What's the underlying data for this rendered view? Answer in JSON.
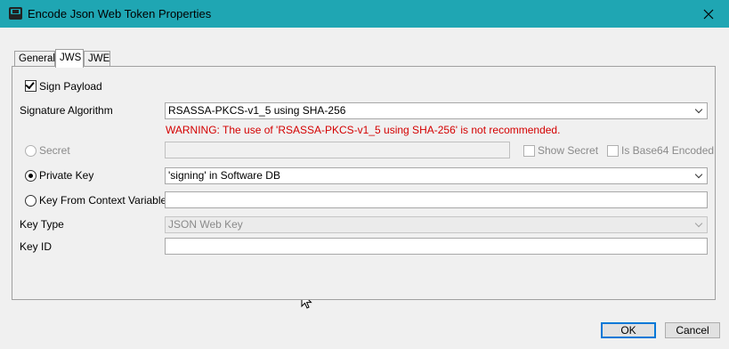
{
  "window": {
    "title": "Encode Json Web Token Properties"
  },
  "tabs": [
    {
      "label": "General"
    },
    {
      "label": "JWS"
    },
    {
      "label": "JWE"
    }
  ],
  "jws": {
    "sign_payload_label": "Sign Payload",
    "sign_payload_checked": true,
    "signature_algorithm_label": "Signature Algorithm",
    "signature_algorithm_value": "RSASSA-PKCS-v1_5 using SHA-256",
    "warning": "WARNING: The use of 'RSASSA-PKCS-v1_5 using SHA-256' is not recommended.",
    "secret_label": "Secret",
    "secret_value": "",
    "show_secret_label": "Show Secret",
    "is_base64_label": "Is Base64 Encoded",
    "private_key_label": "Private Key",
    "private_key_value": "'signing' in Software DB",
    "key_from_context_label": "Key From Context Variable",
    "key_from_context_value": "",
    "key_type_label": "Key Type",
    "key_type_value": "JSON Web Key",
    "key_id_label": "Key ID",
    "key_id_value": ""
  },
  "buttons": {
    "ok": "OK",
    "cancel": "Cancel"
  },
  "colors": {
    "titlebar": "#1fa6b3",
    "warning": "#d40000",
    "default_button_border": "#0078d7"
  }
}
